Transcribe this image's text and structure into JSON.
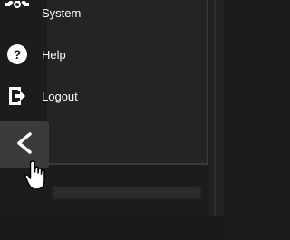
{
  "menu": {
    "items": [
      {
        "label": "System",
        "icon": "gear-icon"
      },
      {
        "label": "Help",
        "icon": "help-icon"
      },
      {
        "label": "Logout",
        "icon": "logout-icon"
      }
    ],
    "collapse_icon": "chevron-left-icon"
  },
  "colors": {
    "background": "#1c1c1c",
    "panel": "#242424",
    "collapse_tab": "#3b3b3b",
    "text": "#ffffff"
  }
}
